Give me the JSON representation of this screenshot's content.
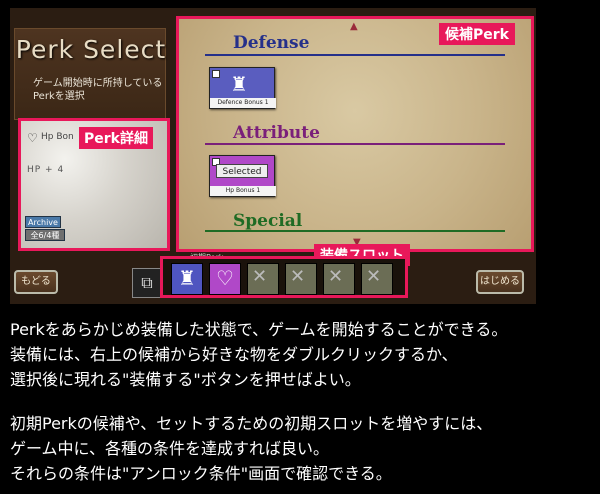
{
  "game": {
    "title": "Perk Select",
    "title_sub": "ゲーム開始時に所持しているPerkを選択",
    "detail": {
      "perk_name": "Hp Bon",
      "tag": "Perk詳細",
      "effect": "HP + 4",
      "archive_label": "Archive",
      "archive_value": "全6/4種"
    },
    "candidates": {
      "tag": "候補Perk",
      "categories": [
        {
          "name": "Defense",
          "color": "#25308a"
        },
        {
          "name": "Attribute",
          "color": "#7a1f7a"
        },
        {
          "name": "Special",
          "color": "#1f6b24"
        }
      ],
      "perks": [
        {
          "label": "Defence Bonus 1",
          "color": "#5a5dbf"
        },
        {
          "label": "Hp Bonus 1",
          "color": "#b048c8",
          "state": "Selected"
        }
      ]
    },
    "bottom": {
      "back_button": "もどる",
      "start_button": "はじめる",
      "slots_tag": "装備スロット",
      "slots_header": "初期Perk",
      "slots": [
        {
          "kind": "defense",
          "color": "#4f55c0",
          "icon": "shield-person-icon"
        },
        {
          "kind": "attribute",
          "color": "#b048c8",
          "icon": "heart-icon"
        },
        {
          "kind": "locked",
          "color": "#6b6d55",
          "icon": "lock-icon"
        },
        {
          "kind": "locked",
          "color": "#6b6d55",
          "icon": "lock-icon"
        },
        {
          "kind": "locked",
          "color": "#6b6d55",
          "icon": "lock-icon"
        },
        {
          "kind": "locked",
          "color": "#6b6d55",
          "icon": "lock-icon"
        }
      ]
    }
  },
  "description": {
    "p1_line1": "Perkをあらかじめ装備した状態で、ゲームを開始することができる。",
    "p1_line2": "装備には、右上の候補から好きな物をダブルクリックするか、",
    "p1_line3": "選択後に現れる\"装備する\"ボタンを押せばよい。",
    "p2_line1": "初期Perkの候補や、セットするための初期スロットを増やすには、",
    "p2_line2": "ゲーム中に、各種の条件を達成すれば良い。",
    "p2_line3": "それらの条件は\"アンロック条件\"画面で確認できる。"
  }
}
